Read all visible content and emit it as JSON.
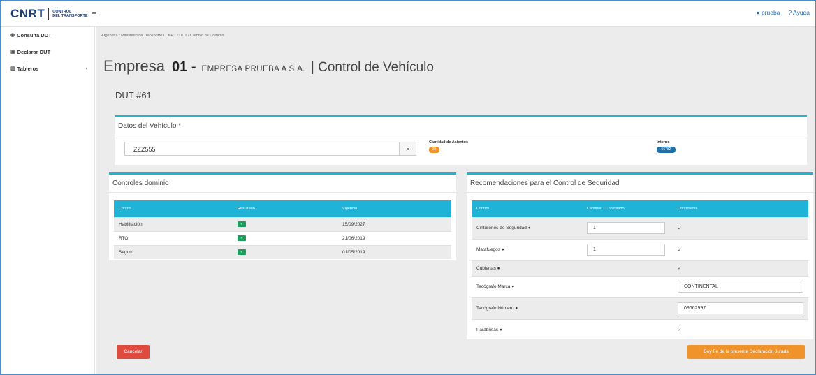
{
  "brand": {
    "logo": "CNRT",
    "sub_line1": "CONTROL",
    "sub_line2": "DEL TRANSPORTE",
    "menu_icon": "hamburger-icon"
  },
  "topbar": {
    "user": "prueba",
    "help": "Ayuda"
  },
  "sidebar": {
    "items": [
      {
        "icon": "tachometer-icon",
        "label": "Consulta DUT"
      },
      {
        "icon": "save-icon",
        "label": "Declarar DUT"
      },
      {
        "icon": "chart-icon",
        "label": "Tableros",
        "chevron": "‹"
      }
    ]
  },
  "breadcrumb": "Argentina / Ministerio de Transporte / CNRT / DUT / Cambio de Dominio",
  "title": {
    "empresa": "Empresa",
    "code": "01 -",
    "name": "EMPRESA PRUEBA A S.A.",
    "control": "| Control de Vehículo"
  },
  "dut": "DUT #61",
  "vehiculo": {
    "heading": "Datos del Vehículo *",
    "dominio": "ZZZ555",
    "asientos_label": "Cantidad de Asientos",
    "asientos_value": "39",
    "interno_label": "Interno",
    "interno_value": "56782"
  },
  "controles": {
    "heading": "Controles dominio",
    "headers": [
      "Control",
      "Resultado",
      "Vigencia"
    ],
    "rows": [
      {
        "control": "Habilitación",
        "resultado": "✓",
        "vigencia": "15/09/2027"
      },
      {
        "control": "RTO",
        "resultado": "✓",
        "vigencia": "21/06/2019"
      },
      {
        "control": "Seguro",
        "resultado": "✓",
        "vigencia": "01/05/2019"
      }
    ]
  },
  "recomendaciones": {
    "heading": "Recomendaciones para el Control de Seguridad",
    "headers": [
      "Control",
      "Cantidad / Controlado",
      "Controlado"
    ],
    "rows": [
      {
        "control": "Cinturones de Seguridad",
        "cantidad": "1",
        "controlado": "✓"
      },
      {
        "control": "Matafuegos",
        "cantidad": "1",
        "controlado": "✓"
      },
      {
        "control": "Cubiertas",
        "cantidad": "",
        "controlado": "✓"
      },
      {
        "control": "Tacógrafo Marca",
        "cantidad": "",
        "controlado": "CONTINENTAL"
      },
      {
        "control": "Tacógrafo Número",
        "cantidad": "",
        "controlado": "09662997"
      },
      {
        "control": "Parabrisas",
        "cantidad": "",
        "controlado": "✓"
      }
    ]
  },
  "buttons": {
    "cancel": "Cancelar",
    "fin": "Doy Fe de la presente Declaración Jurada"
  },
  "colors": {
    "accent": "#1fb3d7",
    "brand": "#1a3e73",
    "danger": "#e04a3f",
    "warning": "#f0932b",
    "success": "#1e9e5e"
  }
}
